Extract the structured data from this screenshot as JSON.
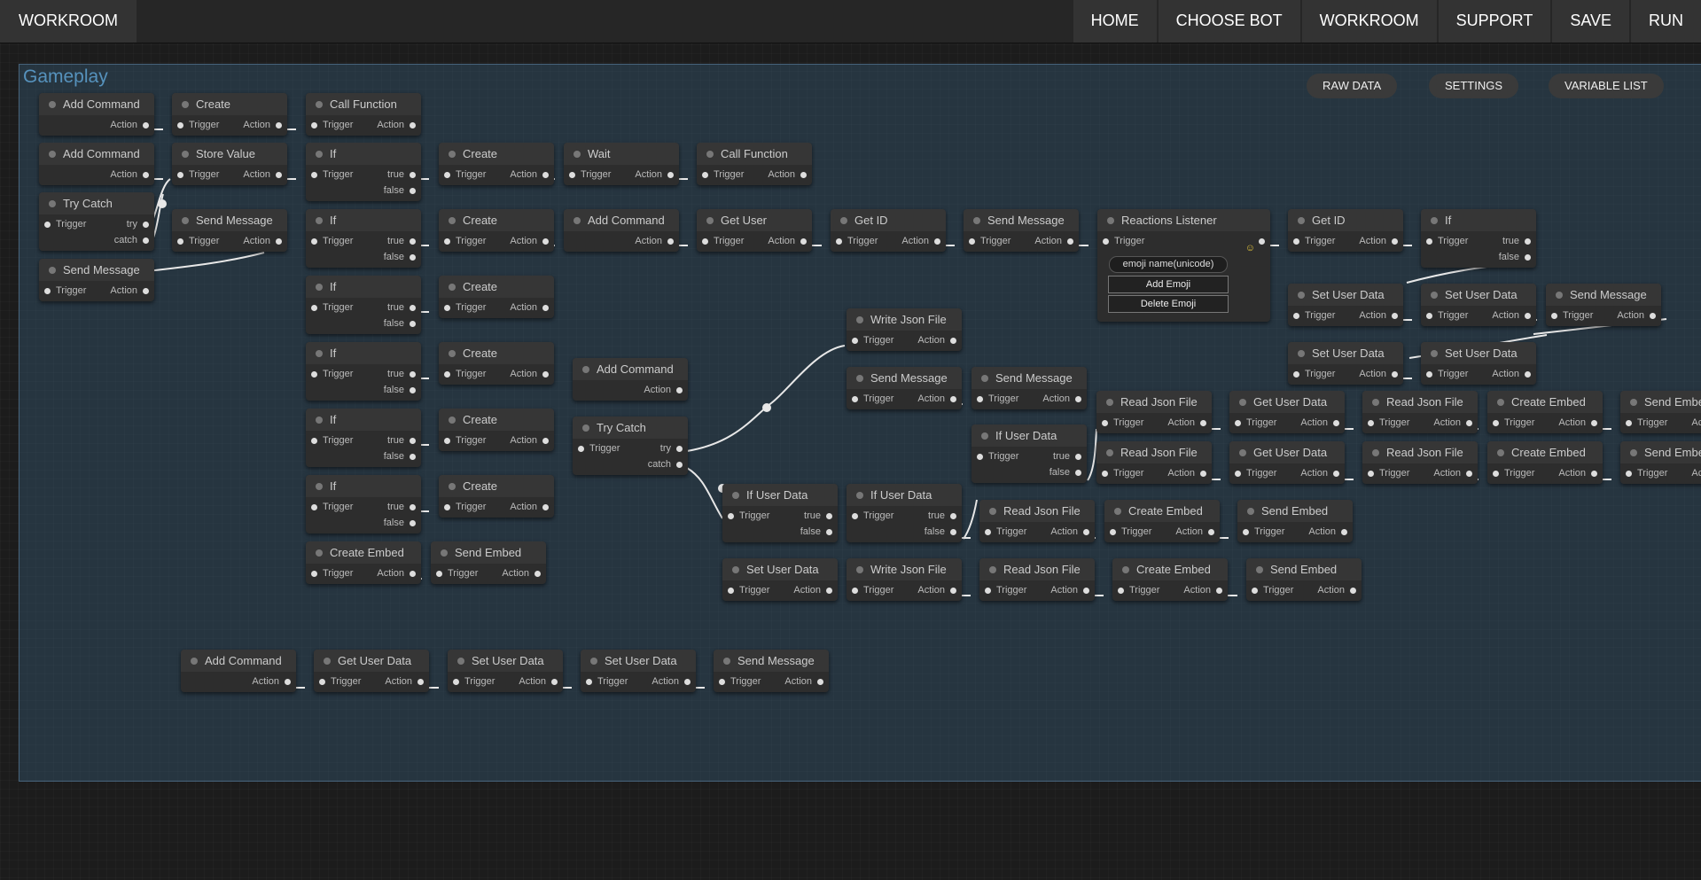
{
  "app": {
    "brand": "WORKROOM"
  },
  "nav": [
    "HOME",
    "CHOOSE BOT",
    "WORKROOM",
    "SUPPORT",
    "SAVE",
    "RUN"
  ],
  "group": {
    "title": "Gameplay",
    "buttons": [
      "RAW DATA",
      "SETTINGS",
      "VARIABLE LIST"
    ]
  },
  "reactions_listener": {
    "emoji_icon": "smiley-icon",
    "input_placeholder": "emoji name(unicode)",
    "add_label": "Add Emoji",
    "delete_label": "Delete Emoji"
  },
  "nodes": [
    {
      "id": "n1",
      "title": "Add Command",
      "outputs": [
        "Action"
      ]
    },
    {
      "id": "n2",
      "title": "Create",
      "inputs": [
        "Trigger"
      ],
      "outputs": [
        "Action"
      ]
    },
    {
      "id": "n3",
      "title": "Call Function",
      "inputs": [
        "Trigger"
      ],
      "outputs": [
        "Action"
      ]
    },
    {
      "id": "n4",
      "title": "Add Command",
      "outputs": [
        "Action"
      ]
    },
    {
      "id": "n5",
      "title": "Store Value",
      "inputs": [
        "Trigger"
      ],
      "outputs": [
        "Action"
      ]
    },
    {
      "id": "n6",
      "title": "If",
      "inputs": [
        "Trigger"
      ],
      "outputs": [
        "true",
        "false"
      ]
    },
    {
      "id": "n7",
      "title": "Create",
      "inputs": [
        "Trigger"
      ],
      "outputs": [
        "Action"
      ]
    },
    {
      "id": "n8",
      "title": "Wait",
      "inputs": [
        "Trigger"
      ],
      "outputs": [
        "Action"
      ]
    },
    {
      "id": "n9",
      "title": "Call Function",
      "inputs": [
        "Trigger"
      ],
      "outputs": [
        "Action"
      ]
    },
    {
      "id": "n10",
      "title": "Try Catch",
      "inputs": [
        "Trigger"
      ],
      "outputs": [
        "try",
        "catch"
      ]
    },
    {
      "id": "n11",
      "title": "Send Message",
      "inputs": [
        "Trigger"
      ],
      "outputs": [
        "Action"
      ]
    },
    {
      "id": "n12",
      "title": "If",
      "inputs": [
        "Trigger"
      ],
      "outputs": [
        "true",
        "false"
      ]
    },
    {
      "id": "n13",
      "title": "Create",
      "inputs": [
        "Trigger"
      ],
      "outputs": [
        "Action"
      ]
    },
    {
      "id": "n14",
      "title": "Add Command",
      "outputs": [
        "Action"
      ]
    },
    {
      "id": "n15",
      "title": "Get User",
      "inputs": [
        "Trigger"
      ],
      "outputs": [
        "Action"
      ]
    },
    {
      "id": "n16",
      "title": "Get ID",
      "inputs": [
        "Trigger"
      ],
      "outputs": [
        "Action"
      ]
    },
    {
      "id": "n17",
      "title": "Send Message",
      "inputs": [
        "Trigger"
      ],
      "outputs": [
        "Action"
      ]
    },
    {
      "id": "n18",
      "title": "Reactions Listener",
      "inputs": [
        "Trigger"
      ],
      "outputs": [
        ""
      ]
    },
    {
      "id": "n19",
      "title": "Get ID",
      "inputs": [
        "Trigger"
      ],
      "outputs": [
        "Action"
      ]
    },
    {
      "id": "n20",
      "title": "If",
      "inputs": [
        "Trigger"
      ],
      "outputs": [
        "true",
        "false"
      ]
    },
    {
      "id": "n21",
      "title": "Send Message",
      "inputs": [
        "Trigger"
      ],
      "outputs": [
        "Action"
      ]
    },
    {
      "id": "n22",
      "title": "If",
      "inputs": [
        "Trigger"
      ],
      "outputs": [
        "true",
        "false"
      ]
    },
    {
      "id": "n23",
      "title": "Create",
      "inputs": [
        "Trigger"
      ],
      "outputs": [
        "Action"
      ]
    },
    {
      "id": "n24",
      "title": "Set User Data",
      "inputs": [
        "Trigger"
      ],
      "outputs": [
        "Action"
      ]
    },
    {
      "id": "n25",
      "title": "Set User Data",
      "inputs": [
        "Trigger"
      ],
      "outputs": [
        "Action"
      ]
    },
    {
      "id": "n26",
      "title": "Send Message",
      "inputs": [
        "Trigger"
      ],
      "outputs": [
        "Action"
      ]
    },
    {
      "id": "n27",
      "title": "Write Json File",
      "inputs": [
        "Trigger"
      ],
      "outputs": [
        "Action"
      ]
    },
    {
      "id": "n28",
      "title": "If",
      "inputs": [
        "Trigger"
      ],
      "outputs": [
        "true",
        "false"
      ]
    },
    {
      "id": "n29",
      "title": "Create",
      "inputs": [
        "Trigger"
      ],
      "outputs": [
        "Action"
      ]
    },
    {
      "id": "n30",
      "title": "Add Command",
      "outputs": [
        "Action"
      ]
    },
    {
      "id": "n31",
      "title": "Set User Data",
      "inputs": [
        "Trigger"
      ],
      "outputs": [
        "Action"
      ]
    },
    {
      "id": "n32",
      "title": "Set User Data",
      "inputs": [
        "Trigger"
      ],
      "outputs": [
        "Action"
      ]
    },
    {
      "id": "n33",
      "title": "Send Message",
      "inputs": [
        "Trigger"
      ],
      "outputs": [
        "Action"
      ]
    },
    {
      "id": "n34",
      "title": "Send Message",
      "inputs": [
        "Trigger"
      ],
      "outputs": [
        "Action"
      ]
    },
    {
      "id": "n35",
      "title": "Read Json File",
      "inputs": [
        "Trigger"
      ],
      "outputs": [
        "Action"
      ]
    },
    {
      "id": "n36",
      "title": "Get User Data",
      "inputs": [
        "Trigger"
      ],
      "outputs": [
        "Action"
      ]
    },
    {
      "id": "n37",
      "title": "Read Json File",
      "inputs": [
        "Trigger"
      ],
      "outputs": [
        "Action"
      ]
    },
    {
      "id": "n38",
      "title": "Create Embed",
      "inputs": [
        "Trigger"
      ],
      "outputs": [
        "Action"
      ]
    },
    {
      "id": "n39",
      "title": "Send Embed",
      "inputs": [
        "Trigger"
      ],
      "outputs": [
        "Action"
      ]
    },
    {
      "id": "n40",
      "title": "If",
      "inputs": [
        "Trigger"
      ],
      "outputs": [
        "true",
        "false"
      ]
    },
    {
      "id": "n41",
      "title": "Create",
      "inputs": [
        "Trigger"
      ],
      "outputs": [
        "Action"
      ]
    },
    {
      "id": "n42",
      "title": "Try Catch",
      "inputs": [
        "Trigger"
      ],
      "outputs": [
        "try",
        "catch"
      ]
    },
    {
      "id": "n43",
      "title": "If User Data",
      "inputs": [
        "Trigger"
      ],
      "outputs": [
        "true",
        "false"
      ]
    },
    {
      "id": "n44",
      "title": "Read Json File",
      "inputs": [
        "Trigger"
      ],
      "outputs": [
        "Action"
      ]
    },
    {
      "id": "n45",
      "title": "Get User Data",
      "inputs": [
        "Trigger"
      ],
      "outputs": [
        "Action"
      ]
    },
    {
      "id": "n46",
      "title": "Read Json File",
      "inputs": [
        "Trigger"
      ],
      "outputs": [
        "Action"
      ]
    },
    {
      "id": "n47",
      "title": "Create Embed",
      "inputs": [
        "Trigger"
      ],
      "outputs": [
        "Action"
      ]
    },
    {
      "id": "n48",
      "title": "Send Embed",
      "inputs": [
        "Trigger"
      ],
      "outputs": [
        "Action"
      ]
    },
    {
      "id": "n49",
      "title": "If",
      "inputs": [
        "Trigger"
      ],
      "outputs": [
        "true",
        "false"
      ]
    },
    {
      "id": "n50",
      "title": "Create",
      "inputs": [
        "Trigger"
      ],
      "outputs": [
        "Action"
      ]
    },
    {
      "id": "n51",
      "title": "If User Data",
      "inputs": [
        "Trigger"
      ],
      "outputs": [
        "true",
        "false"
      ]
    },
    {
      "id": "n52",
      "title": "If User Data",
      "inputs": [
        "Trigger"
      ],
      "outputs": [
        "true",
        "false"
      ]
    },
    {
      "id": "n53",
      "title": "Read Json File",
      "inputs": [
        "Trigger"
      ],
      "outputs": [
        "Action"
      ]
    },
    {
      "id": "n54",
      "title": "Create Embed",
      "inputs": [
        "Trigger"
      ],
      "outputs": [
        "Action"
      ]
    },
    {
      "id": "n55",
      "title": "Send Embed",
      "inputs": [
        "Trigger"
      ],
      "outputs": [
        "Action"
      ]
    },
    {
      "id": "n56",
      "title": "Create Embed",
      "inputs": [
        "Trigger"
      ],
      "outputs": [
        "Action"
      ]
    },
    {
      "id": "n57",
      "title": "Send Embed",
      "inputs": [
        "Trigger"
      ],
      "outputs": [
        "Action"
      ]
    },
    {
      "id": "n58",
      "title": "Set User Data",
      "inputs": [
        "Trigger"
      ],
      "outputs": [
        "Action"
      ]
    },
    {
      "id": "n59",
      "title": "Write Json File",
      "inputs": [
        "Trigger"
      ],
      "outputs": [
        "Action"
      ]
    },
    {
      "id": "n60",
      "title": "Read Json File",
      "inputs": [
        "Trigger"
      ],
      "outputs": [
        "Action"
      ]
    },
    {
      "id": "n61",
      "title": "Create Embed",
      "inputs": [
        "Trigger"
      ],
      "outputs": [
        "Action"
      ]
    },
    {
      "id": "n62",
      "title": "Send Embed",
      "inputs": [
        "Trigger"
      ],
      "outputs": [
        "Action"
      ]
    },
    {
      "id": "n63",
      "title": "Add Command",
      "outputs": [
        "Action"
      ]
    },
    {
      "id": "n64",
      "title": "Get User Data",
      "inputs": [
        "Trigger"
      ],
      "outputs": [
        "Action"
      ]
    },
    {
      "id": "n65",
      "title": "Set User Data",
      "inputs": [
        "Trigger"
      ],
      "outputs": [
        "Action"
      ]
    },
    {
      "id": "n66",
      "title": "Set User Data",
      "inputs": [
        "Trigger"
      ],
      "outputs": [
        "Action"
      ]
    },
    {
      "id": "n67",
      "title": "Send Message",
      "inputs": [
        "Trigger"
      ],
      "outputs": [
        "Action"
      ]
    }
  ]
}
